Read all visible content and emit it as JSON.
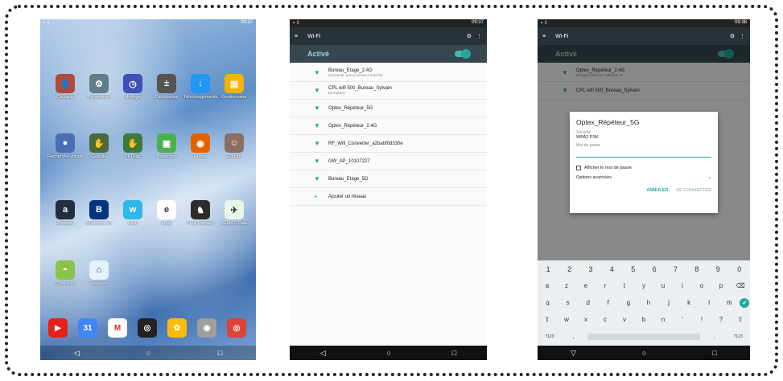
{
  "phone1": {
    "status_time": "09:37",
    "rows": [
      [
        {
          "label": "Contacts",
          "icon": "contacts-icon",
          "color": "#b24a3a",
          "glyph": "👤"
        },
        {
          "label": "Paramètres",
          "icon": "gear-icon",
          "color": "#5f7d8b",
          "glyph": "⚙"
        },
        {
          "label": "Horloge",
          "icon": "clock-icon",
          "color": "#3f51b5",
          "glyph": "◷"
        },
        {
          "label": "Calculatrice",
          "icon": "calculator-icon",
          "color": "#555555",
          "glyph": "±"
        },
        {
          "label": "Téléchargements",
          "icon": "download-icon",
          "color": "#2196f3",
          "glyph": "↓"
        },
        {
          "label": "Gestionnaire",
          "icon": "folder-icon",
          "color": "#f4b400",
          "glyph": "▤"
        }
      ],
      [
        {
          "label": "Recherche vocale",
          "icon": "mic-icon",
          "color": "#4a6fb5",
          "glyph": "●"
        },
        {
          "label": "Gesture",
          "icon": "gesture-icon",
          "color": "#4a6b3a",
          "glyph": "✋"
        },
        {
          "label": "Fil Drag",
          "icon": "drag-icon",
          "color": "#3d7a3a",
          "glyph": "✋"
        },
        {
          "label": "Projection",
          "icon": "projection-icon",
          "color": "#4caf50",
          "glyph": "▣"
        },
        {
          "label": "Firefox",
          "icon": "firefox-icon",
          "color": "#e66000",
          "glyph": "◉"
        },
        {
          "label": "Empire",
          "icon": "game-icon",
          "color": "#8d6e63",
          "glyph": "☺"
        }
      ],
      [
        {
          "label": "Amazon",
          "icon": "amazon-icon",
          "color": "#232f3e",
          "glyph": "a"
        },
        {
          "label": "Booking.com",
          "icon": "booking-icon",
          "color": "#003580",
          "glyph": "B"
        },
        {
          "label": "Wish",
          "icon": "wish-icon",
          "color": "#2fb7ec",
          "glyph": "w"
        },
        {
          "label": "eBay",
          "icon": "ebay-icon",
          "color": "#ffffff",
          "glyph": "e"
        },
        {
          "label": "Final Fantasy",
          "icon": "game2-icon",
          "color": "#2c2c2c",
          "glyph": "♞"
        },
        {
          "label": "SEMAC Data",
          "icon": "semac-icon",
          "color": "#e8f5e9",
          "glyph": "✈"
        }
      ],
      [
        {
          "label": "Continuité",
          "icon": "android-icon",
          "color": "#8bc34a",
          "glyph": "◓"
        },
        {
          "label": "Homesys",
          "icon": "homesys-icon",
          "color": "#e3f2fd",
          "glyph": "⌂"
        }
      ]
    ],
    "dock": [
      {
        "icon": "youtube-icon",
        "color": "#e62117",
        "glyph": "▶"
      },
      {
        "icon": "calendar-icon",
        "color": "#4285f4",
        "glyph": "31"
      },
      {
        "icon": "gmail-icon",
        "color": "#ffffff",
        "glyph": "M"
      },
      {
        "icon": "iconia-icon",
        "color": "#222222",
        "glyph": "◎"
      },
      {
        "icon": "photos-icon",
        "color": "#fbbc05",
        "glyph": "✿"
      },
      {
        "icon": "camera-icon",
        "color": "#9e9e9e",
        "glyph": "◉"
      },
      {
        "icon": "chrome-icon",
        "color": "#db4437",
        "glyph": "◎"
      }
    ]
  },
  "phone2": {
    "status_time": "09:37",
    "toolbar_title": "Wi-Fi",
    "active_label": "Activé",
    "networks": [
      {
        "name": "Bureau_Etage_2.4G",
        "status": "Connecté, aucun accès à Internet"
      },
      {
        "name": "CPL wifi 500_Bureau_Sylvain",
        "status": "Enregistré"
      },
      {
        "name": "Optex_Répéteur_5G",
        "status": ""
      },
      {
        "name": "Optex_Répéteur_2.4G",
        "status": ""
      },
      {
        "name": "RF_Wifi_Converter_a2babf0d330e",
        "status": ""
      },
      {
        "name": "GW_AP_10107227",
        "status": ""
      },
      {
        "name": "Bureau_Etage_5G",
        "status": ""
      },
      {
        "name": "Ajouter un réseau",
        "status": ""
      }
    ]
  },
  "phone3": {
    "status_time": "09:38",
    "toolbar_title": "Wi-Fi",
    "active_label": "Activé",
    "bg_networks": [
      {
        "name": "Optex_Répéteur_2.4G",
        "status": "Récupération de l'adresse IP..."
      },
      {
        "name": "CPL wifi 500_Bureau_Sylvain",
        "status": ""
      }
    ],
    "dialog": {
      "title": "Optex_Répéteur_5G",
      "security_label": "Sécurité",
      "security_value": "WPA2 PSK",
      "password_label": "Mot de passe",
      "show_password": "Afficher le mot de passe",
      "advanced": "Options avancées",
      "cancel": "ANNULER",
      "connect": "SE CONNECTER"
    },
    "keyboard": {
      "row1": [
        "1",
        "2",
        "3",
        "4",
        "5",
        "6",
        "7",
        "8",
        "9",
        "0"
      ],
      "row2": [
        "a",
        "z",
        "e",
        "r",
        "t",
        "y",
        "u",
        "i",
        "o",
        "p",
        "⌫"
      ],
      "row3": [
        "q",
        "s",
        "d",
        "f",
        "g",
        "h",
        "j",
        "k",
        "l",
        "m",
        "✔"
      ],
      "row4": [
        "⇧",
        "w",
        "x",
        "c",
        "v",
        "b",
        "n",
        "'",
        "!",
        "?",
        "⇧"
      ],
      "row5_left": "?123",
      "row5_comma": ",",
      "row5_dot": ".",
      "row5_right": "?123"
    }
  }
}
